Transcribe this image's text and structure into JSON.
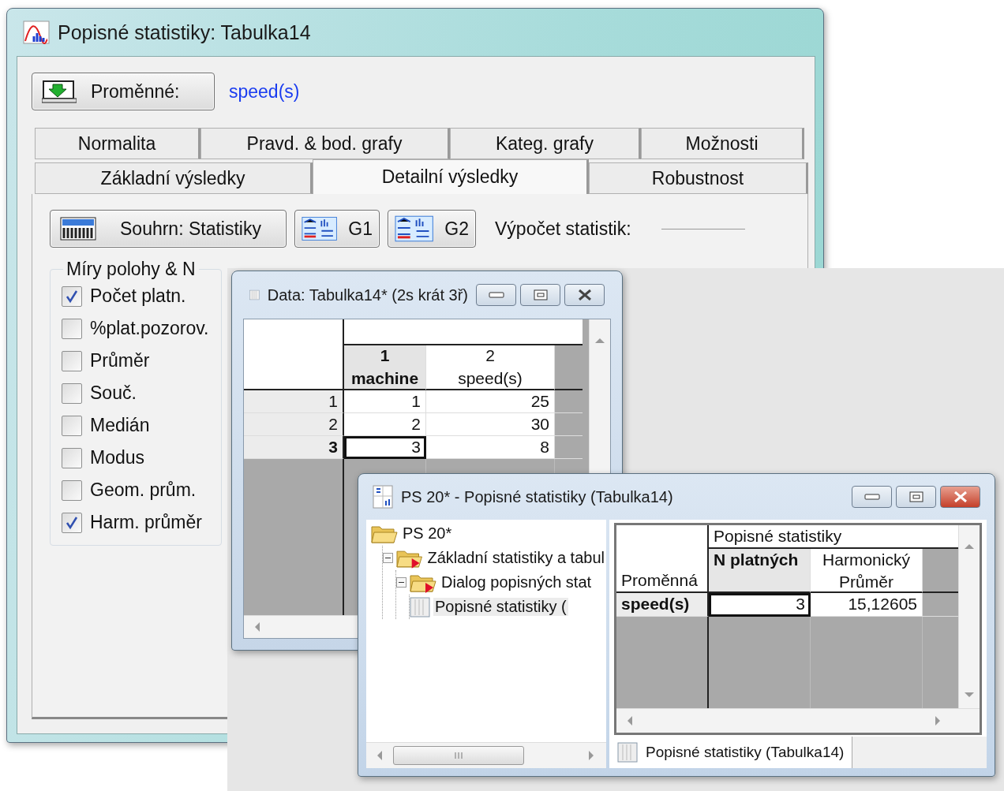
{
  "dialog": {
    "title": "Popisné statistiky: Tabulka14",
    "variables_button": "Proměnné:",
    "variables_value": "speed(s)",
    "tab_rows": [
      {
        "tabs": [
          {
            "label": "Normalita",
            "selected": false
          },
          {
            "label": "Pravd. & bod. grafy",
            "selected": false
          },
          {
            "label": "Kateg. grafy",
            "selected": false
          },
          {
            "label": "Možnosti",
            "selected": false
          }
        ]
      },
      {
        "tabs": [
          {
            "label": "Základní výsledky",
            "selected": false
          },
          {
            "label": "Detailní výsledky",
            "selected": true
          },
          {
            "label": "Robustnost",
            "selected": false
          }
        ]
      }
    ],
    "summary_button": "Souhrn: Statistiky",
    "graph_buttons": [
      "G1",
      "G2"
    ],
    "compute_label": "Výpočet statistik:",
    "group": {
      "title": "Míry polohy & N",
      "options": [
        {
          "label": "Počet platn.",
          "checked": true
        },
        {
          "label": "%plat.pozorov.",
          "checked": false
        },
        {
          "label": "Průměr",
          "checked": false
        },
        {
          "label": "Souč.",
          "checked": false
        },
        {
          "label": "Medián",
          "checked": false
        },
        {
          "label": "Modus",
          "checked": false
        },
        {
          "label": "Geom. prům.",
          "checked": false
        },
        {
          "label": "Harm. průměr",
          "checked": true
        }
      ]
    }
  },
  "data_window": {
    "title": "Data: Tabulka14* (2s krát 3ř)",
    "columns": [
      {
        "number": "1",
        "name": "machine",
        "selected": true
      },
      {
        "number": "2",
        "name": "speed(s)",
        "selected": false
      }
    ],
    "rows": [
      {
        "label": "1",
        "cells": [
          "1",
          "25"
        ],
        "selected": false
      },
      {
        "label": "2",
        "cells": [
          "2",
          "30"
        ],
        "selected": false
      },
      {
        "label": "3",
        "cells": [
          "3",
          "8"
        ],
        "selected": true
      }
    ]
  },
  "results_window": {
    "title": "PS 20* - Popisné statistiky (Tabulka14)",
    "tree": [
      {
        "label": "PS 20*",
        "kind": "folder",
        "selected": false,
        "children": [
          {
            "label": "Základní statistiky a tabul",
            "kind": "folder",
            "selected": false,
            "children": [
              {
                "label": "Dialog popisných stat",
                "kind": "folder",
                "selected": false,
                "children": [
                  {
                    "label": "Popisné statistiky (",
                    "kind": "sheet",
                    "selected": true
                  }
                ]
              }
            ]
          }
        ]
      }
    ],
    "table": {
      "group_header": "Popisné statistiky",
      "row_header": "Proměnná",
      "columns": [
        {
          "label": "N platných",
          "selected": true
        },
        {
          "label": "Harmonický Průměr",
          "selected": false
        }
      ],
      "rows": [
        {
          "label": "speed(s)",
          "cells": [
            "3",
            "15,12605"
          ]
        }
      ]
    },
    "sheet_tab": "Popisné statistiky (Tabulka14)"
  }
}
